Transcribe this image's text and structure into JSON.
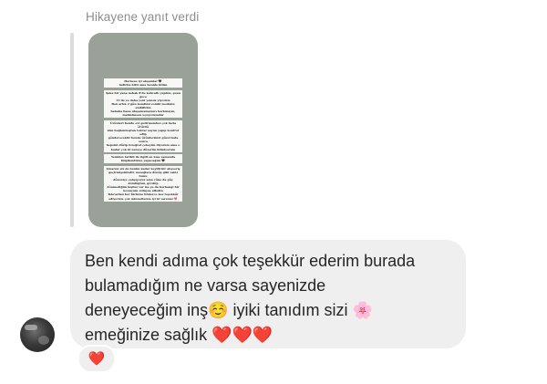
{
  "reply_header": {
    "label": "Hikayene yanıt verdi"
  },
  "story_preview": {
    "text_blocks": [
      "Herkese iyi akşamlar 🖤\nludirim bitti ama benide bitim",
      "Şaka bir yana nebak 8'de kahvaltı yaptım, şuan gece\n11'de ve daha yeni yemek yiyorum\nBen artık 2 gün kendimi zombi modunu alabilirim\nbahaha bana ulaşamamamızı korkmayın,\nmahisimsen uçuyorumdur",
      "Ürünleri bende evi getirmenden çok fazla ötürdü\nkim bağlanmıştan tekrar sayım yapıp kontrol edip\ngönderecektir bende ürünlerinizi güzel kata sonra\nhepsini düzip fotoğraf çekeyim diyorum ama o\nkadar çok ki nereye düzerim bilmiyorum",
      "Yeniden tarihli ile ilgili en kısa zamanda\nbilgilendirme yapacağım 🖤",
      "Umarım siz de benim kadar keyifli bir alışveriş\ngeçirmişsinizdir, mesajlara dönüş gibi vakti bunu\ndüzeniçe çalışıyoruz ama cüne da güç döndüğüm, gördüp\ndönmediğim kişiler var ise ya da herhangi bir\nkonuyum olduysa affedin\nTekrardan her birinize binlerce kez teşekkür\nediyorum çok minnettarım iyi ki varsınız 💖"
    ]
  },
  "message": {
    "text": "Ben kendi adıma çok teşekkür ederim burada\nbulamadığım ne varsa sayenizde\ndeneyeceğim inş☺️ iyiki tanıdım sizi 🌸\nemeğinize sağlık ❤️❤️❤️"
  },
  "reaction": {
    "emoji": "❤️",
    "color": "#e0245e"
  },
  "colors": {
    "bubble": "#efefef",
    "story_background": "#9aa198",
    "secondary_text": "#8e8e8e",
    "primary_text": "#262626"
  }
}
